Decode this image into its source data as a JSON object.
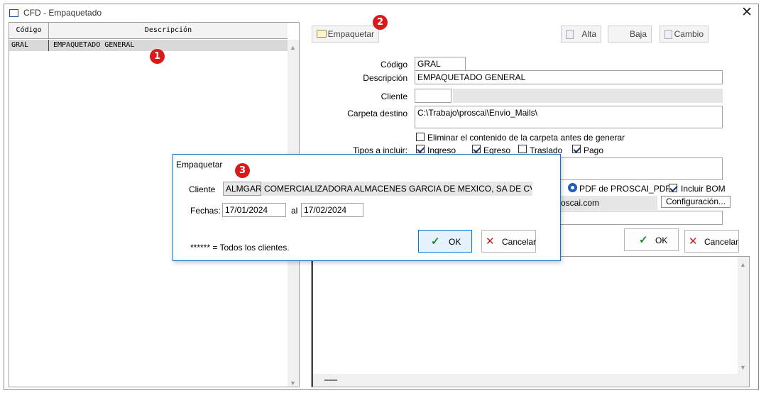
{
  "window": {
    "title": "CFD - Empaquetado"
  },
  "grid": {
    "headers": {
      "codigo": "Código",
      "descripcion": "Descripción"
    },
    "rows": [
      {
        "codigo": "GRAL",
        "descripcion": "EMPAQUETADO GENERAL"
      }
    ]
  },
  "toolbar": {
    "empaquetar": "Empaquetar",
    "alta": "Alta",
    "baja": "Baja",
    "cambio": "Cambio"
  },
  "form": {
    "codigo_label": "Código",
    "codigo_value": "GRAL",
    "descripcion_label": "Descripción",
    "descripcion_value": "EMPAQUETADO GENERAL",
    "cliente_label": "Cliente",
    "cliente_value": "",
    "carpeta_label": "Carpeta destino",
    "carpeta_value": "C:\\Trabajo\\proscai\\Envio_Mails\\",
    "eliminar_label": "Eliminar el contenido de la carpeta antes de generar",
    "tipos_label": "Tipos a incluir:",
    "tipos": {
      "ingreso": "Ingreso",
      "egreso": "Egreso",
      "traslado": "Traslado",
      "pago": "Pago"
    },
    "pdf_label": "PDF de PROSCAI_PDF",
    "bom_label": "Incluir BOM",
    "email_partial": "oscai.com",
    "configuracion": "Configuración..."
  },
  "main_buttons": {
    "ok": "OK",
    "cancelar": "Cancelar"
  },
  "dialog": {
    "title": "Empaquetar",
    "cliente_label": "Cliente",
    "cliente_code": "ALMGAR",
    "cliente_name": "COMERCIALIZADORA ALMACENES GARCIA DE MEXICO, SA DE CV",
    "fechas_label": "Fechas:",
    "fecha_desde": "17/01/2024",
    "al_label": "al",
    "fecha_hasta": "17/02/2024",
    "note": "****** = Todos los clientes.",
    "ok": "OK",
    "cancelar": "Cancelar"
  },
  "badges": [
    "1",
    "2",
    "3"
  ],
  "colors": {
    "badge": "#d91a1a",
    "accent": "#1a73c8",
    "ok_check": "#1f8a1f",
    "cancel_x": "#c02020"
  }
}
